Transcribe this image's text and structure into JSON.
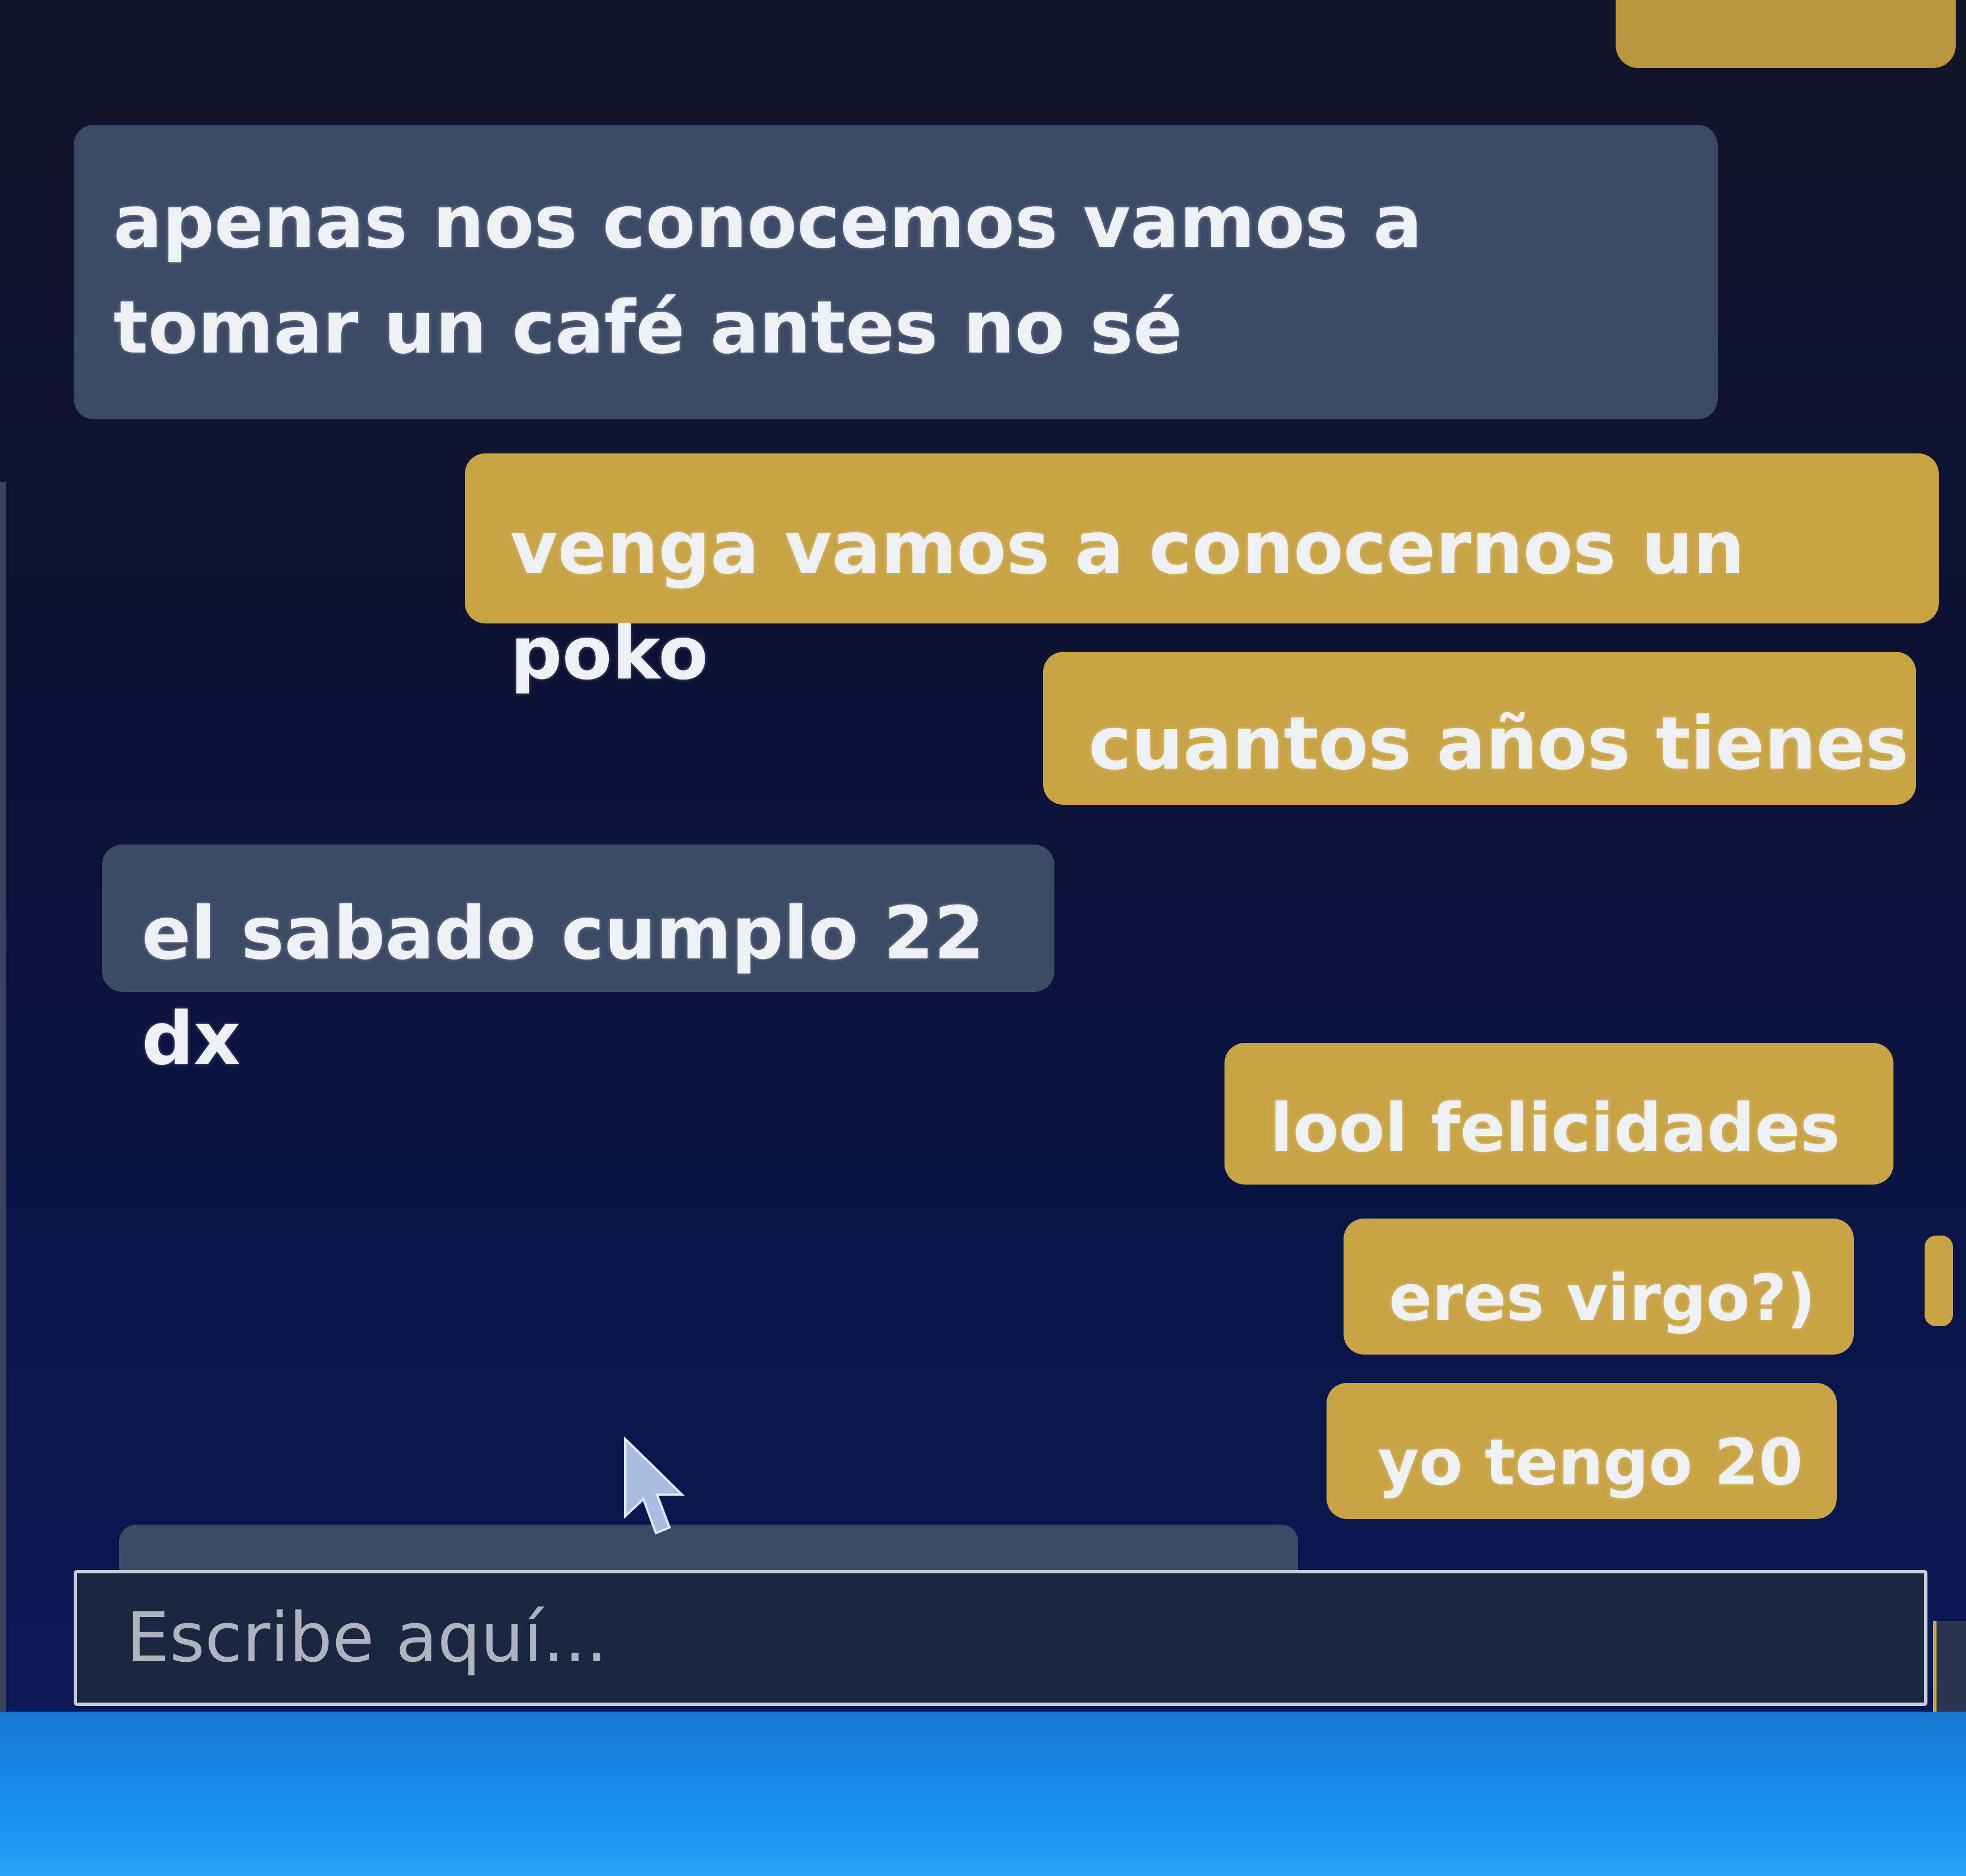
{
  "chat": {
    "messages": [
      {
        "from": "other",
        "text": "apenas nos conocemos vamos a tomar un café antes no sé"
      },
      {
        "from": "me",
        "text": "venga vamos a conocernos un poko"
      },
      {
        "from": "me",
        "text": "cuantos años tienes"
      },
      {
        "from": "other",
        "text": "el sabado cumplo 22 dx"
      },
      {
        "from": "me",
        "text": "lool felicidades"
      },
      {
        "from": "me",
        "text": "eres virgo?)"
      },
      {
        "from": "me",
        "text": "yo tengo 20"
      }
    ]
  },
  "composer": {
    "placeholder": "Escribe aquí..."
  },
  "colors": {
    "incoming_bubble": "#3d4a66",
    "outgoing_bubble": "#c9a447",
    "background": "#0c1236",
    "taskbar": "#1a8ff0"
  },
  "icons": {
    "cursor": "mouse-pointer-icon"
  }
}
